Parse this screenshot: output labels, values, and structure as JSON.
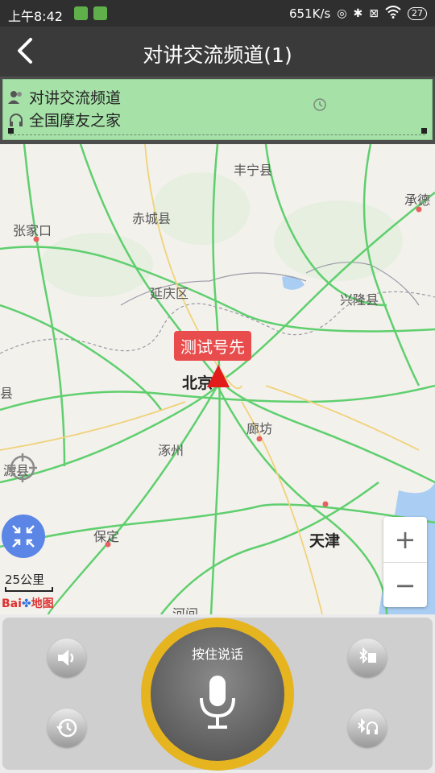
{
  "status_bar": {
    "time": "上午8:42",
    "speed": "651K/s",
    "battery": "27"
  },
  "header": {
    "title": "对讲交流频道(1)"
  },
  "channel_panel": {
    "channel_name": "对讲交流频道",
    "group_name": "全国摩友之家"
  },
  "map": {
    "marker_label": "测试号先",
    "places": [
      "丰宁县",
      "承德",
      "张家口",
      "赤城县",
      "延庆区",
      "兴隆县",
      "北京",
      "廊坊",
      "涿州",
      "保定",
      "天津",
      "县",
      "源县",
      "河间"
    ],
    "scale": "25公里",
    "logo_left": "Bai",
    "logo_right": "地图"
  },
  "controls": {
    "ptt_label": "按住说话"
  },
  "colors": {
    "accent_yellow": "#e5b41f",
    "channel_bg": "#a6e2a8",
    "marker_red": "#e84c4c"
  }
}
